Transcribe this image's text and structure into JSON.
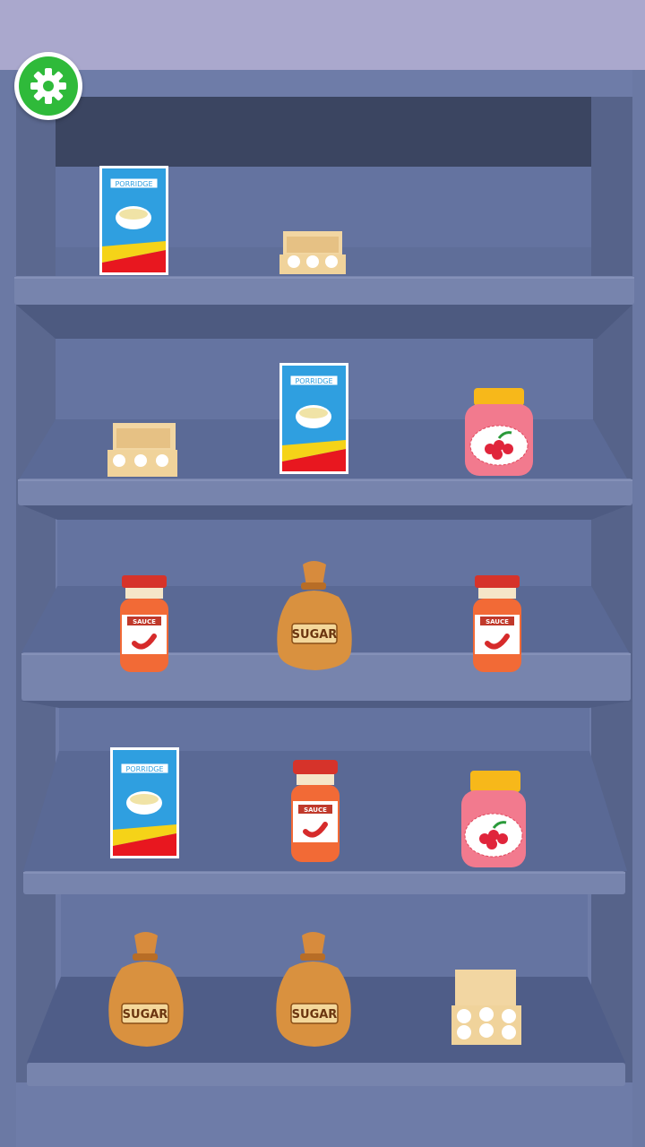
{
  "colors": {
    "wall": "#aaa8cd",
    "shelf_frame": "#6e7ca8",
    "shelf_back": "#5a6890",
    "shelf_board": "#7784ad",
    "floor": "#f6e3b6",
    "settings_green": "#2fba3a"
  },
  "settings_button": {
    "icon": "gear-icon"
  },
  "labels": {
    "porridge": "PORRIDGE",
    "sauce": "SAUCE",
    "sugar": "SUGAR"
  },
  "shelves": [
    {
      "row": 1,
      "items": [
        "porridge",
        "eggs",
        null
      ]
    },
    {
      "row": 2,
      "items": [
        "eggs",
        "porridge",
        "jam"
      ]
    },
    {
      "row": 3,
      "items": [
        "sauce",
        "sugar",
        "sauce"
      ]
    },
    {
      "row": 4,
      "items": [
        "porridge",
        "sauce",
        "jam"
      ]
    },
    {
      "row": 5,
      "items": [
        "sugar",
        "sugar",
        "eggs"
      ]
    }
  ]
}
